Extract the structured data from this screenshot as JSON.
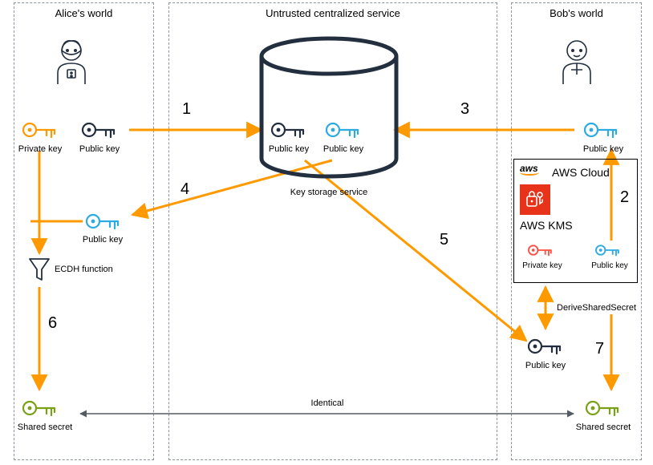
{
  "panels": {
    "alice": {
      "title": "Alice's world"
    },
    "center": {
      "title": "Untrusted centralized service",
      "storage_label": "Key storage service"
    },
    "bob": {
      "title": "Bob's world"
    }
  },
  "alice": {
    "private_key": "Private key",
    "public_key": "Public key",
    "bob_public": "Public key",
    "ecdh": "ECDH function",
    "shared": "Shared secret"
  },
  "center": {
    "alice_public": "Public key",
    "bob_public": "Public key",
    "identical": "Identical"
  },
  "bob": {
    "public_key": "Public key",
    "cloud": {
      "aws": "aws",
      "title": "AWS Cloud",
      "kms": "AWS KMS",
      "private_key": "Private key",
      "public_key": "Public key"
    },
    "derive": "DeriveSharedSecret",
    "alice_public": "Public key",
    "shared": "Shared secret"
  },
  "steps": {
    "s1": "1",
    "s2": "2",
    "s3": "3",
    "s4": "4",
    "s5": "5",
    "s6": "6",
    "s7": "7"
  },
  "colors": {
    "orange": "#FF9900",
    "blue": "#2DAAE1",
    "red": "#FF4F42",
    "green": "#7AA116",
    "ink": "#232F3E"
  }
}
